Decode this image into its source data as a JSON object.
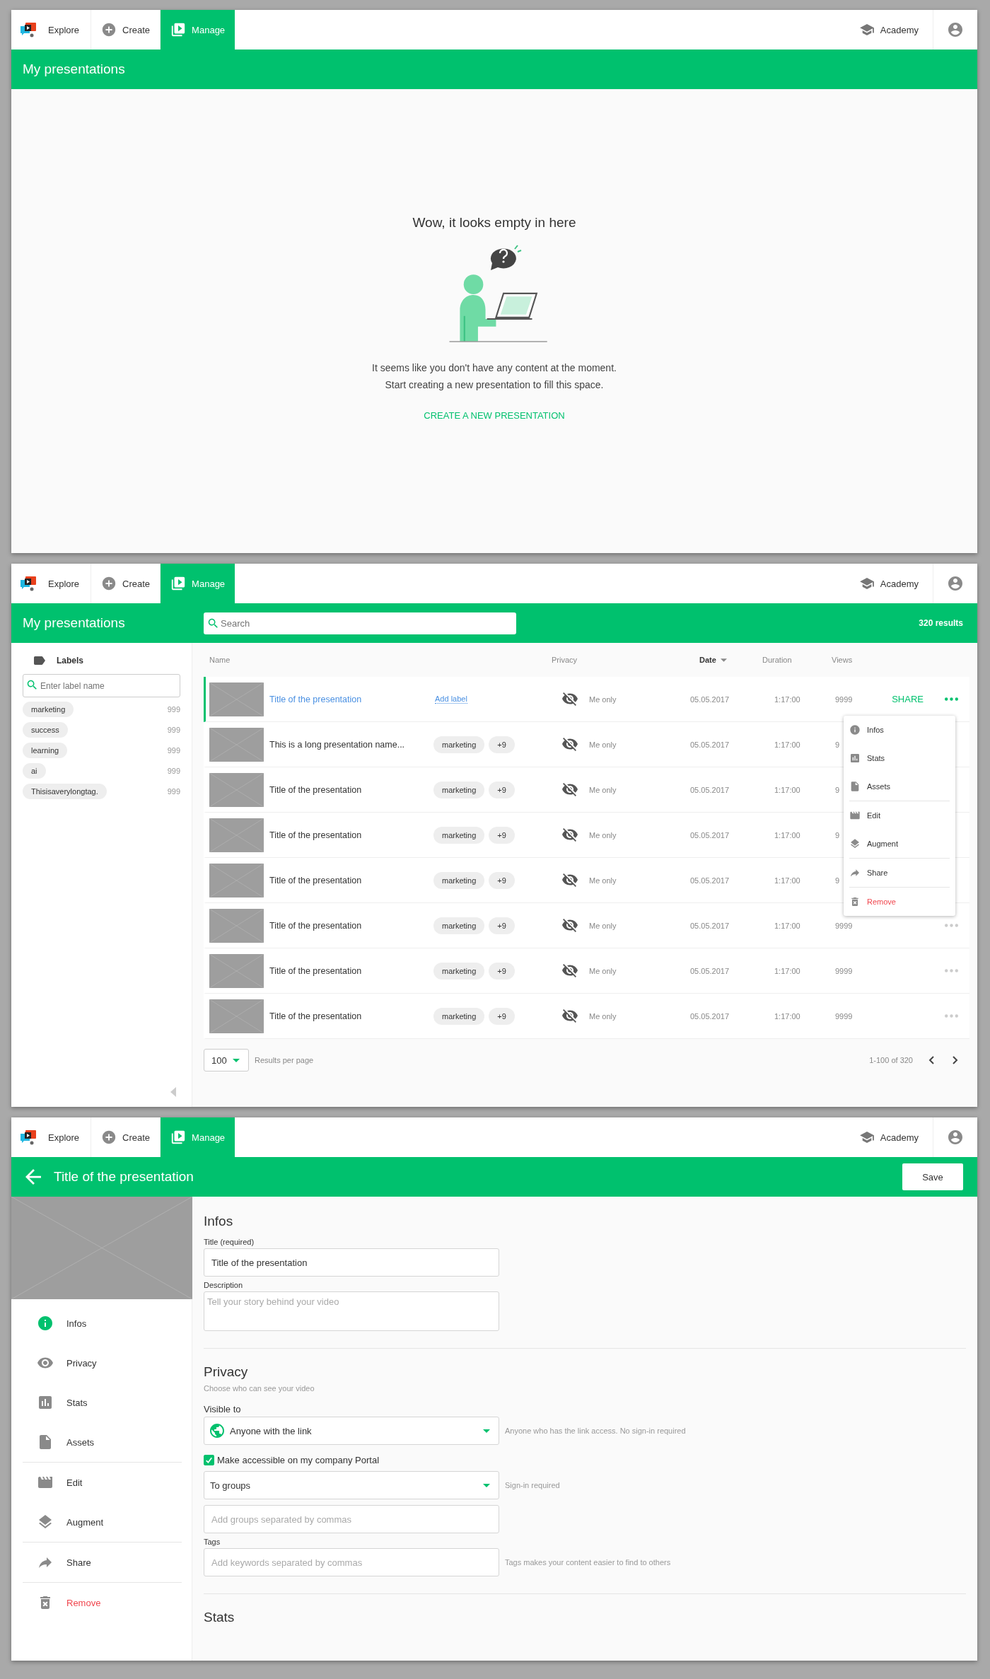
{
  "screens": [
    {
      "kind": "empty",
      "nav": {
        "items": [
          {
            "label": "Explore",
            "kind": "none",
            "selected": false
          },
          {
            "label": "Create",
            "kind": "add",
            "selected": false
          },
          {
            "label": "Manage",
            "kind": "library",
            "selected": true
          }
        ],
        "academy": "Academy"
      },
      "header": {
        "title": "My presentations"
      },
      "empty": {
        "heading": "Wow, it looks empty in here",
        "lines": [
          "It seems like you don't have any content at the moment.",
          "Start creating a new presentation to fill this space."
        ],
        "action": "CREATE A NEW PRESENTATION"
      }
    },
    {
      "kind": "list",
      "nav": {
        "items": [
          {
            "label": "Explore",
            "kind": "none",
            "selected": false
          },
          {
            "label": "Create",
            "kind": "add",
            "selected": false
          },
          {
            "label": "Manage",
            "kind": "library",
            "selected": true
          }
        ],
        "academy": "Academy"
      },
      "header": {
        "title": "My presentations",
        "search_placeholder": "Search",
        "results": "320 results"
      },
      "sidebar": {
        "title": "Labels",
        "search_placeholder": "Enter label name",
        "labels": [
          {
            "name": "marketing",
            "count": "999"
          },
          {
            "name": "success",
            "count": "999"
          },
          {
            "name": "learning",
            "count": "999"
          },
          {
            "name": "ai",
            "count": "999"
          },
          {
            "name": "Thisisaverylongtag.",
            "count": "999"
          }
        ]
      },
      "table": {
        "columns": [
          {
            "label": "Name",
            "sorted": false
          },
          {
            "label": "Privacy",
            "sorted": false
          },
          {
            "label": "Date",
            "sorted": true
          },
          {
            "label": "Duration",
            "sorted": false
          },
          {
            "label": "Views",
            "sorted": false
          }
        ],
        "rows": [
          {
            "title": "Title of the presentation",
            "selected": true,
            "covered": false,
            "add_label": "Add label",
            "labels": [],
            "privacy": "Me only",
            "date": "05.05.2017",
            "duration": "1:17:00",
            "views": "9999",
            "share": "SHARE"
          },
          {
            "title": "This is a long presentation name...",
            "selected": false,
            "covered": true,
            "labels": [
              "marketing"
            ],
            "more_labels": "+9",
            "privacy": "Me only",
            "date": "05.05.2017",
            "duration": "1:17:00",
            "views": "9"
          },
          {
            "title": "Title of the presentation",
            "selected": false,
            "covered": true,
            "labels": [
              "marketing"
            ],
            "more_labels": "+9",
            "privacy": "Me only",
            "date": "05.05.2017",
            "duration": "1:17:00",
            "views": "9"
          },
          {
            "title": "Title of the presentation",
            "selected": false,
            "covered": true,
            "labels": [
              "marketing"
            ],
            "more_labels": "+9",
            "privacy": "Me only",
            "date": "05.05.2017",
            "duration": "1:17:00",
            "views": "9"
          },
          {
            "title": "Title of the presentation",
            "selected": false,
            "covered": true,
            "labels": [
              "marketing"
            ],
            "more_labels": "+9",
            "privacy": "Me only",
            "date": "05.05.2017",
            "duration": "1:17:00",
            "views": "9"
          },
          {
            "title": "Title of the presentation",
            "selected": false,
            "covered": false,
            "labels": [
              "marketing"
            ],
            "more_labels": "+9",
            "privacy": "Me only",
            "date": "05.05.2017",
            "duration": "1:17:00",
            "views": "9999"
          },
          {
            "title": "Title of the presentation",
            "selected": false,
            "covered": false,
            "labels": [
              "marketing"
            ],
            "more_labels": "+9",
            "privacy": "Me only",
            "date": "05.05.2017",
            "duration": "1:17:00",
            "views": "9999"
          },
          {
            "title": "Title of the presentation",
            "selected": false,
            "covered": false,
            "labels": [
              "marketing"
            ],
            "more_labels": "+9",
            "privacy": "Me only",
            "date": "05.05.2017",
            "duration": "1:17:00",
            "views": "9999"
          }
        ],
        "menu": {
          "groups": [
            [
              {
                "label": "Infos",
                "kind": "info",
                "danger": false
              },
              {
                "label": "Stats",
                "kind": "stats",
                "danger": false
              },
              {
                "label": "Assets",
                "kind": "assets",
                "danger": false
              }
            ],
            [
              {
                "label": "Edit",
                "kind": "edit",
                "danger": false
              },
              {
                "label": "Augment",
                "kind": "augment",
                "danger": false
              }
            ],
            [
              {
                "label": "Share",
                "kind": "share",
                "danger": false
              }
            ],
            [
              {
                "label": "Remove",
                "kind": "remove",
                "danger": true
              }
            ]
          ]
        }
      },
      "footer": {
        "per_page": "100",
        "per_page_label": "Results per page",
        "range": "1-100 of 320"
      }
    },
    {
      "kind": "edit",
      "nav": {
        "items": [
          {
            "label": "Explore",
            "kind": "none",
            "selected": false
          },
          {
            "label": "Create",
            "kind": "add",
            "selected": false
          },
          {
            "label": "Manage",
            "kind": "library",
            "selected": true
          }
        ],
        "academy": "Academy"
      },
      "header": {
        "title": "Title of the presentation",
        "save": "Save"
      },
      "sidebar": {
        "groups": [
          [
            {
              "label": "Infos",
              "kind": "info",
              "selected": true,
              "danger": false
            },
            {
              "label": "Privacy",
              "kind": "privacy",
              "selected": false,
              "danger": false
            },
            {
              "label": "Stats",
              "kind": "stats",
              "selected": false,
              "danger": false
            },
            {
              "label": "Assets",
              "kind": "assets",
              "selected": false,
              "danger": false
            }
          ],
          [
            {
              "label": "Edit",
              "kind": "edit",
              "selected": false,
              "danger": false
            },
            {
              "label": "Augment",
              "kind": "augment",
              "selected": false,
              "danger": false
            }
          ],
          [
            {
              "label": "Share",
              "kind": "share",
              "selected": false,
              "danger": false
            }
          ],
          [
            {
              "label": "Remove",
              "kind": "remove",
              "selected": false,
              "danger": true
            }
          ]
        ]
      },
      "form": {
        "infos": {
          "heading": "Infos",
          "title_label": "Title (required)",
          "title_value": "Title of the presentation",
          "description_label": "Description",
          "description_placeholder": "Tell your story behind your video"
        },
        "privacy": {
          "heading": "Privacy",
          "subtitle": "Choose who can see your video",
          "visible_label": "Visible to",
          "visibility": {
            "value": "Anyone with the link",
            "hint": "Anyone who has the link access. No sign-in required"
          },
          "portal": {
            "label": "Make accessible on my company Portal",
            "checked": true
          },
          "audience": {
            "value": "To groups",
            "hint": "Sign-in required"
          },
          "groups_placeholder": "Add groups separated by commas",
          "tags_label": "Tags",
          "tags_placeholder": "Add keywords separated by commas",
          "tags_hint": "Tags makes your content easier to find to others"
        },
        "stats": {
          "heading": "Stats"
        }
      }
    }
  ]
}
